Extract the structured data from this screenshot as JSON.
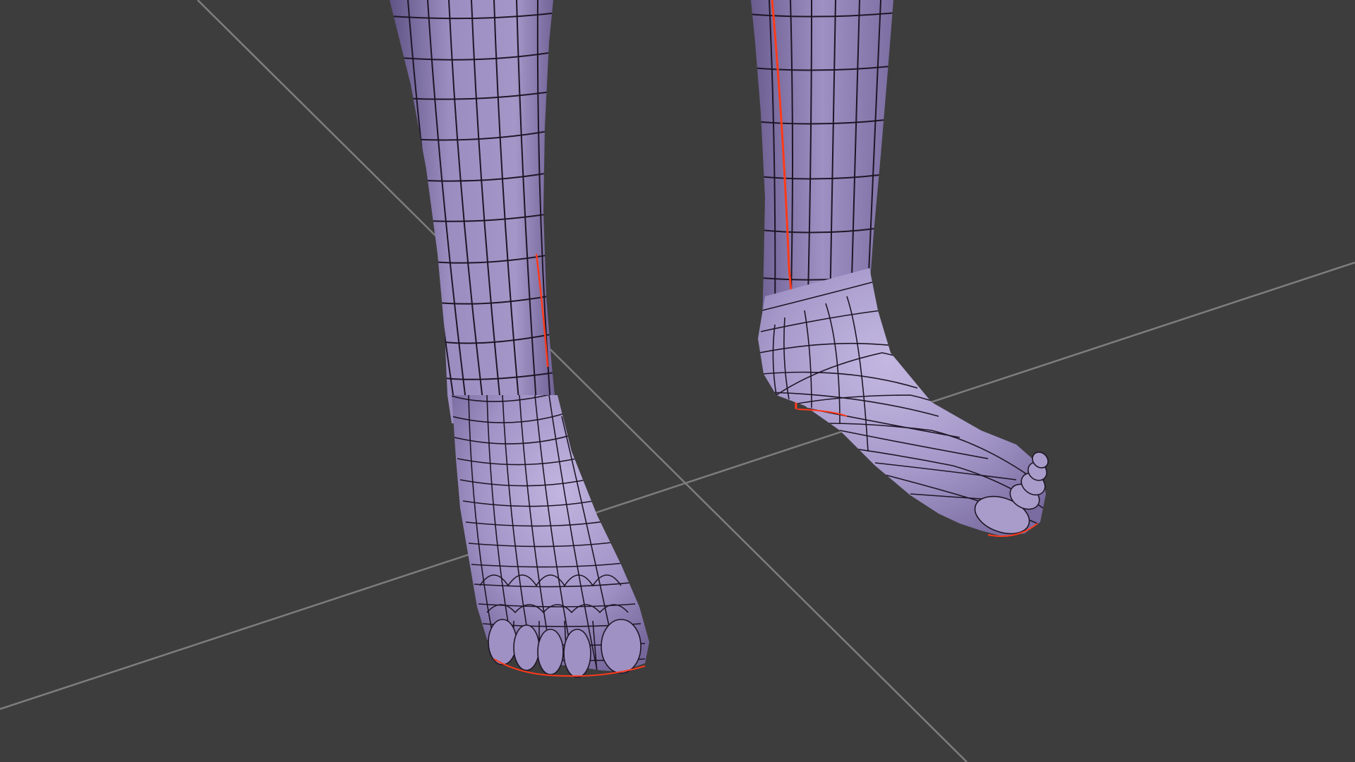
{
  "viewport": {
    "mode": "3d-viewport",
    "background_color": "#3d3d3d",
    "grid_color": "#8c8c8c",
    "object": {
      "name": "feet-mesh",
      "shading": "solid-with-wireframe-overlay",
      "base_color": "#9a8cbf",
      "highlight_color": "#b7aad6",
      "shadow_color": "#6d5f92",
      "wire_color": "#1e1626",
      "seam_color": "#ff3a1a"
    }
  }
}
